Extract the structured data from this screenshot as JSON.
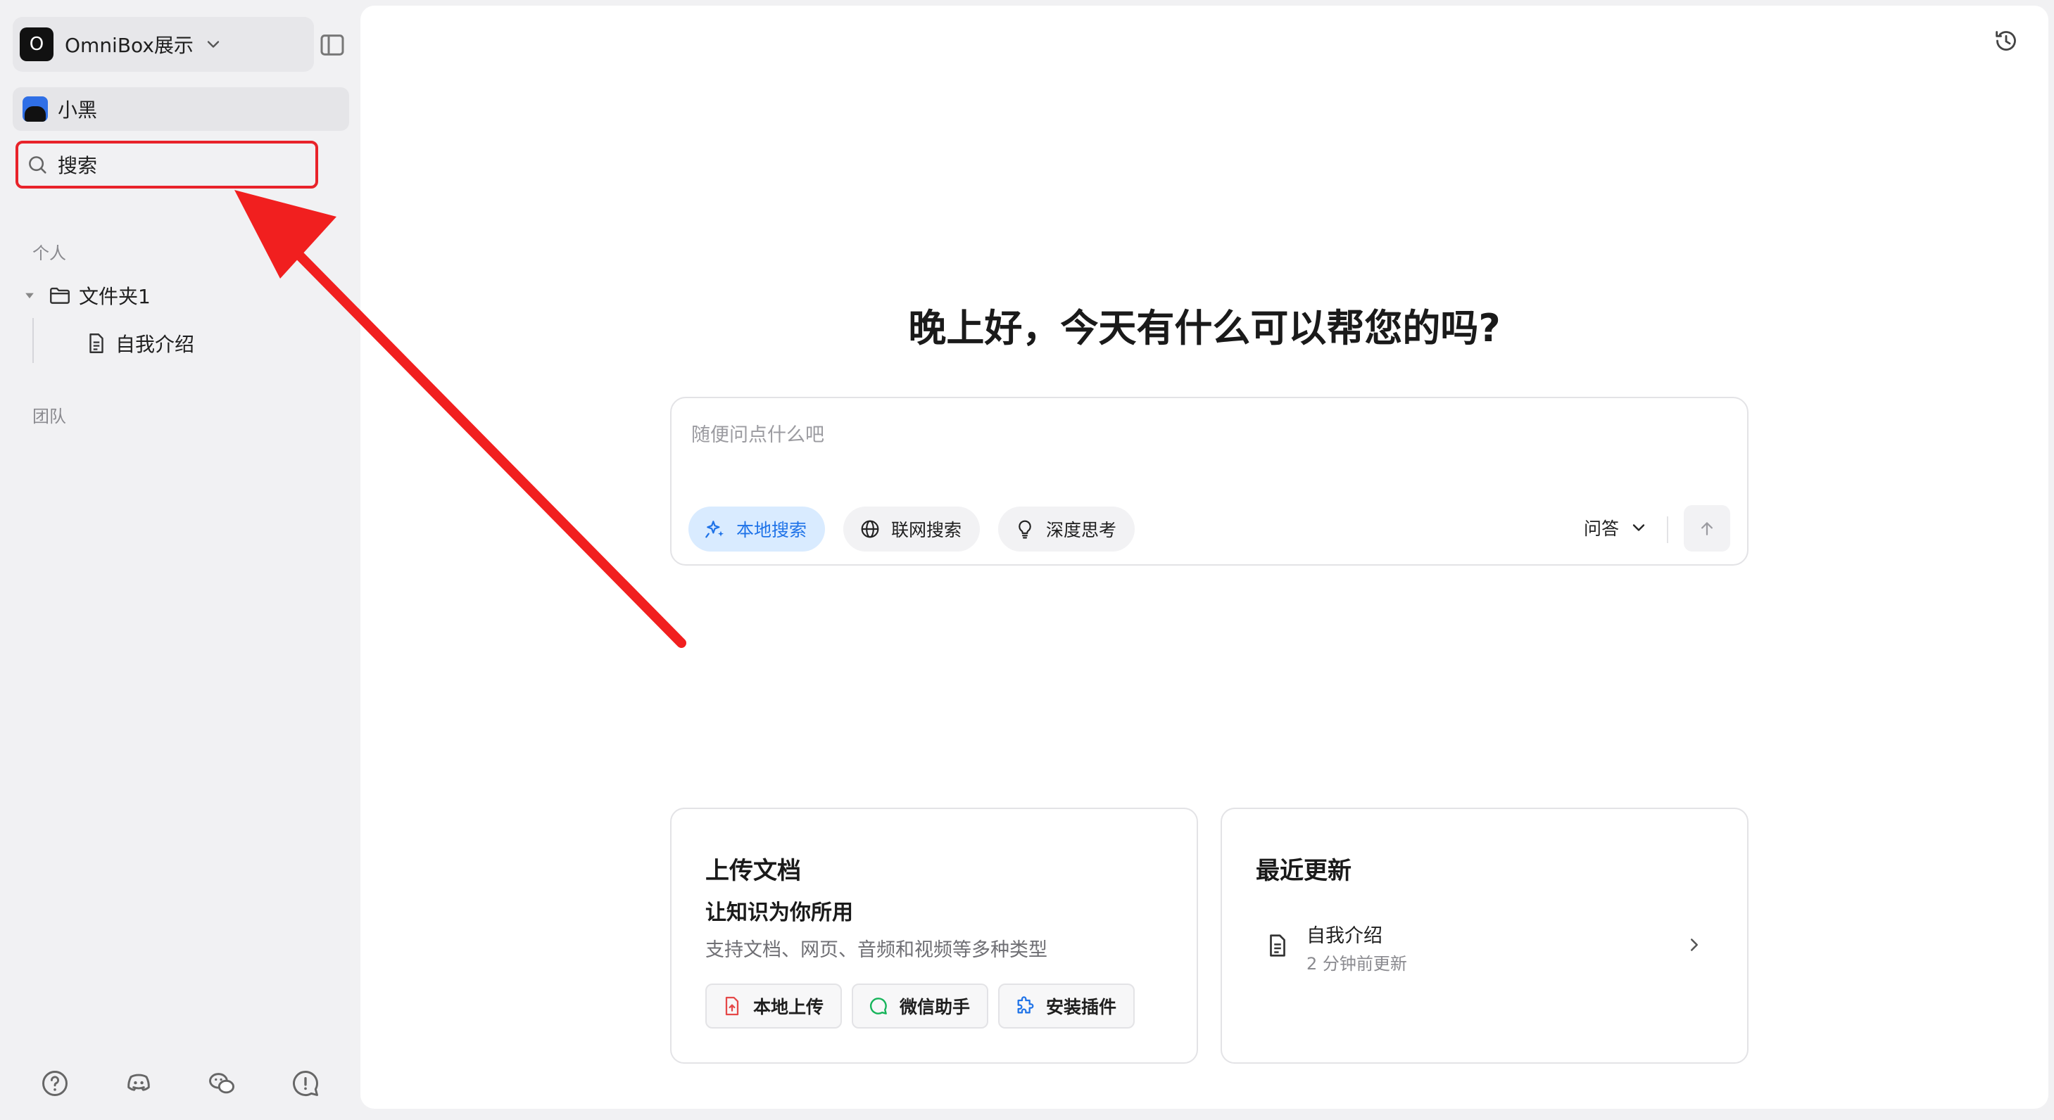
{
  "workspace": {
    "avatar_letter": "O",
    "name": "OmniBox展示"
  },
  "user": {
    "name": "小黑"
  },
  "search": {
    "label": "搜索"
  },
  "sections": {
    "personal": "个人",
    "team": "团队"
  },
  "tree": {
    "folder": "文件夹1",
    "doc": "自我介绍"
  },
  "main": {
    "greeting": "晚上好，今天有什么可以帮您的吗?",
    "input_placeholder": "随便问点什么吧",
    "chips": {
      "local_search": "本地搜索",
      "web_search": "联网搜索",
      "deep_think": "深度思考"
    },
    "mode": "问答"
  },
  "upload_card": {
    "title": "上传文档",
    "subtitle": "让知识为你所用",
    "desc": "支持文档、网页、音频和视频等多种类型",
    "buttons": {
      "local_upload": "本地上传",
      "wechat_helper": "微信助手",
      "install_plugin": "安装插件"
    }
  },
  "recent_card": {
    "title": "最近更新",
    "item_name": "自我介绍",
    "item_time": "2 分钟前更新"
  },
  "colors": {
    "accent": "#1f73e8",
    "chip_active_bg": "#d9ebff",
    "highlight_red": "#e8232a",
    "wechat_green": "#16b45a",
    "upload_red": "#e54848"
  }
}
